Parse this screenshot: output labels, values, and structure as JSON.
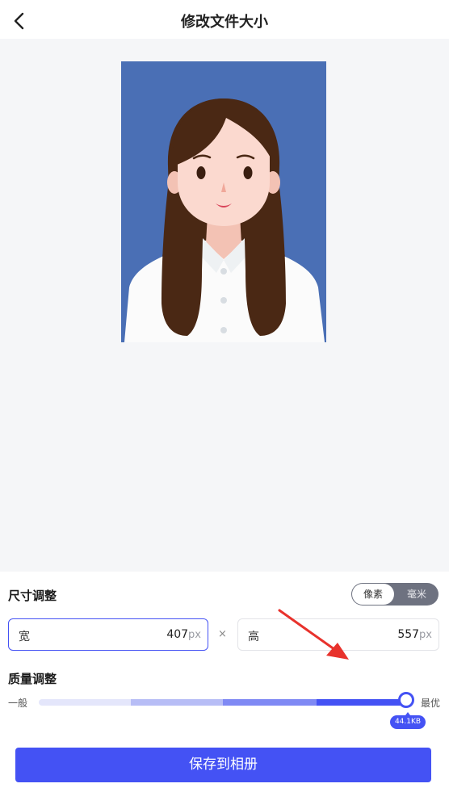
{
  "header": {
    "title": "修改文件大小",
    "back_icon": "chevron-left-icon"
  },
  "preview": {
    "background_color": "#4a6fb5"
  },
  "size": {
    "section_title": "尺寸调整",
    "unit_toggle": {
      "options": [
        "像素",
        "毫米"
      ],
      "selected": "像素"
    },
    "width": {
      "label": "宽",
      "value": "407",
      "unit": "px"
    },
    "separator": "×",
    "height": {
      "label": "高",
      "value": "557",
      "unit": "px"
    }
  },
  "quality": {
    "section_title": "质量调整",
    "min_label": "一般",
    "max_label": "最优",
    "level": 1.0,
    "value_label": "44.1KB"
  },
  "save_button": "保存到相册",
  "colors": {
    "accent": "#4452f4",
    "annotation_arrow": "#e8322c"
  }
}
